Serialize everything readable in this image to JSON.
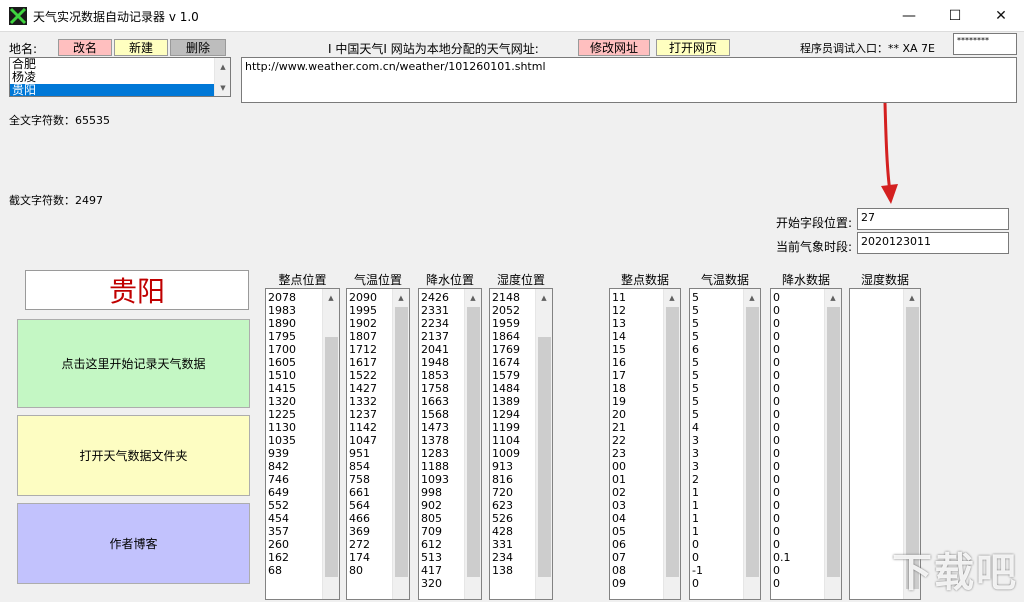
{
  "window": {
    "title": "天气实况数据自动记录器 v 1.0",
    "minimize": "—",
    "maximize": "☐",
    "close": "✕"
  },
  "top": {
    "place_label": "地名:",
    "rename_button": "改名",
    "new_button": "新建",
    "delete_button": "删除",
    "url_label": "I 中国天气I 网站为本地分配的天气网址:",
    "edit_url_button": "修改网址",
    "open_page_button": "打开网页",
    "debug_label": "程序员调试入口：** XA 7E",
    "debug_password": "********",
    "url_value": "http://www.weather.com.cn/weather/101260101.shtml"
  },
  "places": [
    "合肥",
    "杨凌",
    "贵阳"
  ],
  "selected_place_index": 2,
  "stats": {
    "full_text_chars": "全文字符数：65535",
    "cut_text_chars": "截文字符数：2497"
  },
  "fields": {
    "start_pos_label": "开始字段位置:",
    "start_pos_value": "27",
    "current_time_label": "当前气象时段:",
    "current_time_value": "2020123011"
  },
  "city_display": "贵阳",
  "buttons": {
    "start_record": "点击这里开始记录天气数据",
    "open_folder": "打开天气数据文件夹",
    "author_blog": "作者博客"
  },
  "colors": {
    "start_record_bg": "#c4f7c4",
    "open_folder_bg": "#fdfdc2",
    "author_blog_bg": "#c2c2fd",
    "rename_bg": "#ffbfbf",
    "new_bg": "#ffffc0",
    "delete_bg": "#bdbdbd",
    "edit_url_bg": "#ffbfbf",
    "open_page_bg": "#ffffc0",
    "city_color": "#c00000",
    "arrow_color": "#d42020"
  },
  "columns": [
    {
      "header": "整点位置",
      "values": [
        "2078",
        "1983",
        "1890",
        "1795",
        "1700",
        "1605",
        "1510",
        "1415",
        "1320",
        "1225",
        "1130",
        "1035",
        "939",
        "842",
        "746",
        "649",
        "552",
        "454",
        "357",
        "260",
        "162",
        "68"
      ]
    },
    {
      "header": "气温位置",
      "values": [
        "2090",
        "1995",
        "1902",
        "1807",
        "1712",
        "1617",
        "1522",
        "1427",
        "1332",
        "1237",
        "1142",
        "1047",
        "951",
        "854",
        "758",
        "661",
        "564",
        "466",
        "369",
        "272",
        "174",
        "80"
      ]
    },
    {
      "header": "降水位置",
      "values": [
        "2426",
        "2331",
        "2234",
        "2137",
        "2041",
        "1948",
        "1853",
        "1758",
        "1663",
        "1568",
        "1473",
        "1378",
        "1283",
        "1188",
        "1093",
        "998",
        "902",
        "805",
        "709",
        "612",
        "513",
        "417",
        "320"
      ]
    },
    {
      "header": "湿度位置",
      "values": [
        "2148",
        "2052",
        "1959",
        "1864",
        "1769",
        "1674",
        "1579",
        "1484",
        "1389",
        "1294",
        "1199",
        "1104",
        "1009",
        "913",
        "816",
        "720",
        "623",
        "526",
        "428",
        "331",
        "234",
        "138"
      ]
    },
    {
      "header": "整点数据",
      "values": [
        "11",
        "12",
        "13",
        "14",
        "15",
        "16",
        "17",
        "18",
        "19",
        "20",
        "21",
        "22",
        "23",
        "00",
        "01",
        "02",
        "03",
        "04",
        "05",
        "06",
        "07",
        "08",
        "09"
      ]
    },
    {
      "header": "气温数据",
      "values": [
        "5",
        "5",
        "5",
        "5",
        "6",
        "5",
        "5",
        "5",
        "5",
        "5",
        "4",
        "3",
        "3",
        "3",
        "2",
        "1",
        "1",
        "1",
        "1",
        "0",
        "0",
        "-1",
        "0"
      ]
    },
    {
      "header": "降水数据",
      "values": [
        "0",
        "0",
        "0",
        "0",
        "0",
        "0",
        "0",
        "0",
        "0",
        "0",
        "0",
        "0",
        "0",
        "0",
        "0",
        "0",
        "0",
        "0",
        "0",
        "0",
        "0.1",
        "0",
        "0"
      ]
    },
    {
      "header": "湿度数据",
      "values": []
    }
  ],
  "watermark": "下载吧"
}
